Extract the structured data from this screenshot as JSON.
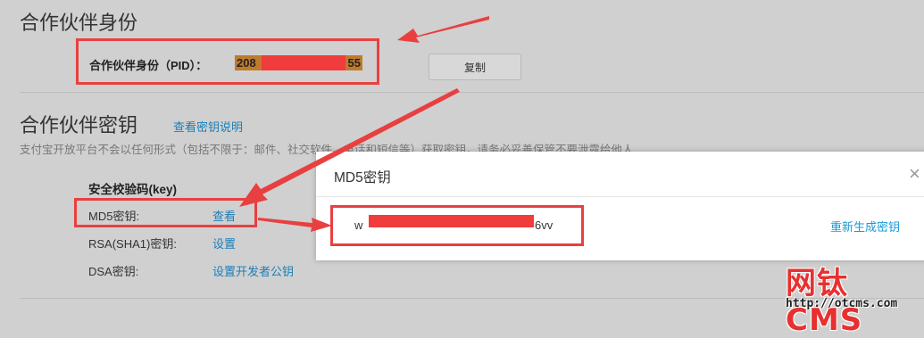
{
  "partner_id": {
    "title": "合作伙伴身份",
    "label": "合作伙伴身份（PID）：",
    "value_prefix": "208",
    "value_suffix": "55",
    "copy_label": "复制"
  },
  "partner_key": {
    "title": "合作伙伴密钥",
    "help_link": "查看密钥说明",
    "description": "支付宝开放平台不会以任何形式（包括不限于：邮件、社交软件、电话和短信等）获取密钥，请务必妥善保管不要泄露给他人",
    "section_label": "安全校验码(key)",
    "rows": [
      {
        "label": "MD5密钥:",
        "action": "查看"
      },
      {
        "label": "RSA(SHA1)密钥:",
        "action": "设置"
      },
      {
        "label": "DSA密钥:",
        "action": "设置开发者公钥"
      }
    ]
  },
  "modal": {
    "title": "MD5密钥",
    "close_icon": "×",
    "key_prefix": "w",
    "key_suffix": "6vv",
    "regen_label": "重新生成密钥"
  },
  "watermark": {
    "brand": "网钛CMS",
    "url": "http://otcms.com"
  },
  "colors": {
    "annotation_red": "#e84040",
    "link_blue": "#1a7fb8",
    "pid_highlight": "#c07a2c"
  }
}
